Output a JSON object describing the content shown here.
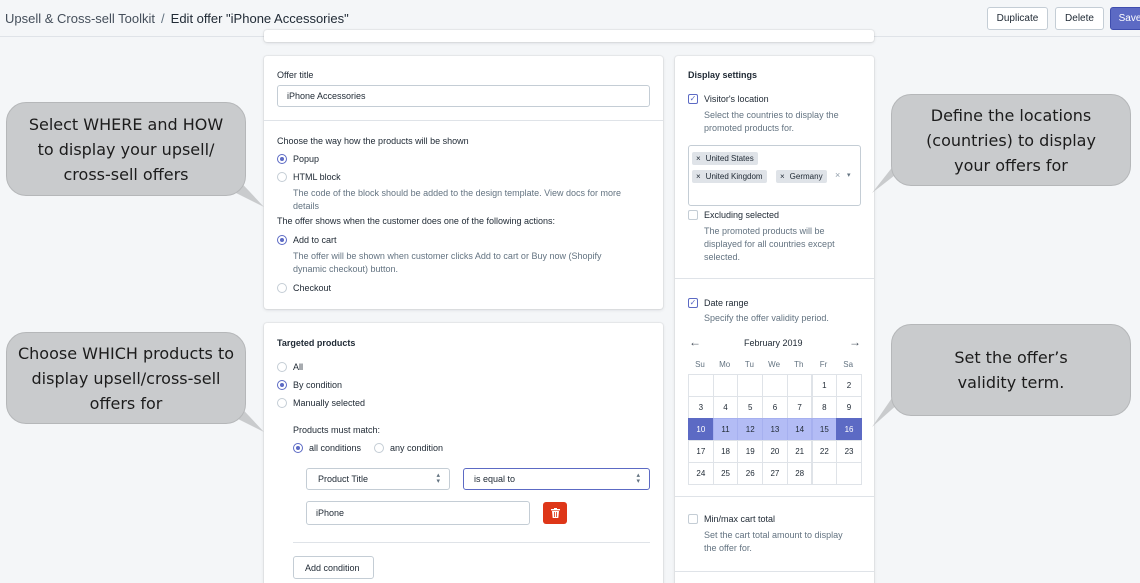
{
  "header": {
    "app_name": "Upsell & Cross-sell Toolkit",
    "separator": "/",
    "page_title": "Edit offer \"iPhone Accessories\"",
    "duplicate_label": "Duplicate",
    "delete_label": "Delete",
    "save_label": "Save"
  },
  "offer": {
    "title_label": "Offer title",
    "title_value": "iPhone Accessories",
    "display_way_label": "Choose the way how the products will be shown",
    "popup_label": "Popup",
    "html_block_label": "HTML block",
    "html_block_help_1": "The code of the block should be added to the design template. View docs for more",
    "html_block_help_2": "details",
    "actions_label": "The offer shows when the customer does one of the following actions:",
    "add_to_cart_label": "Add to cart",
    "add_to_cart_help_1": "The offer will be shown when customer clicks Add to cart or Buy now (Shopify",
    "add_to_cart_help_2": "dynamic checkout) button.",
    "checkout_label": "Checkout"
  },
  "targeted": {
    "heading": "Targeted products",
    "all_label": "All",
    "by_condition_label": "By condition",
    "manual_label": "Manually selected",
    "must_match_label": "Products must match:",
    "all_conditions_label": "all conditions",
    "any_condition_label": "any condition",
    "field_select": "Product Title",
    "operator_select": "is equal to",
    "value": "iPhone",
    "add_condition_label": "Add condition"
  },
  "display_settings": {
    "heading": "Display settings",
    "visitor_location_label": "Visitor's location",
    "visitor_location_help_1": "Select the countries to display the",
    "visitor_location_help_2": "promoted products for.",
    "countries": [
      "United States",
      "United Kingdom",
      "Germany"
    ],
    "excluding_label": "Excluding selected",
    "excluding_help_1": "The promoted products will be",
    "excluding_help_2": "displayed for all countries except",
    "excluding_help_3": "selected.",
    "date_range_label": "Date range",
    "date_range_help": "Specify the offer validity period.",
    "month_label": "February 2019",
    "weekdays": [
      "Su",
      "Mo",
      "Tu",
      "We",
      "Th",
      "Fr",
      "Sa"
    ],
    "min_max_label": "Min/max cart total",
    "min_max_help_1": "Set the cart total amount to display",
    "min_max_help_2": "the offer for."
  },
  "calendar": {
    "weeks": [
      [
        "",
        "",
        "",
        "",
        "",
        "1",
        "2"
      ],
      [
        "3",
        "4",
        "5",
        "6",
        "7",
        "8",
        "9"
      ],
      [
        "10",
        "11",
        "12",
        "13",
        "14",
        "15",
        "16"
      ],
      [
        "17",
        "18",
        "19",
        "20",
        "21",
        "22",
        "23"
      ],
      [
        "24",
        "25",
        "26",
        "27",
        "28",
        "",
        ""
      ]
    ],
    "range_start": "10",
    "range_end": "16"
  },
  "callouts": {
    "where_how": "Select WHERE and HOW to display your upsell/ cross-sell offers",
    "which_products": "Choose WHICH products to display upsell/cross-sell offers for",
    "locations": "Define the locations (countries) to display your offers for",
    "validity": "Set the offer’s validity term."
  },
  "colors": {
    "accent": "#5c6ac4",
    "range": "#b3bcf5",
    "delete_red": "#de3618",
    "callout_gray": "#c9cbcd"
  }
}
